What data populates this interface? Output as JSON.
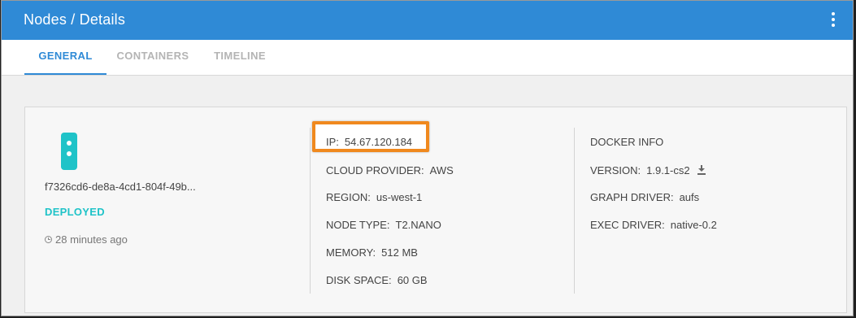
{
  "header": {
    "title": "Nodes / Details",
    "menu_icon": "more-vert-icon"
  },
  "tabs": [
    {
      "label": "GENERAL",
      "active": true
    },
    {
      "label": "CONTAINERS",
      "active": false
    },
    {
      "label": "TIMELINE",
      "active": false
    }
  ],
  "node": {
    "id": "f7326cd6-de8a-4cd1-804f-49b...",
    "status": "DEPLOYED",
    "time_ago": "28 minutes ago",
    "icon": "node-icon"
  },
  "details": [
    {
      "label": "IP:",
      "value": "54.67.120.184"
    },
    {
      "label": "CLOUD PROVIDER:",
      "value": "AWS"
    },
    {
      "label": "REGION:",
      "value": "us-west-1"
    },
    {
      "label": "NODE TYPE:",
      "value": "T2.NANO"
    },
    {
      "label": "MEMORY:",
      "value": "512 MB"
    },
    {
      "label": "DISK SPACE:",
      "value": "60 GB"
    }
  ],
  "docker": {
    "title": "DOCKER INFO",
    "version_label": "VERSION:",
    "version_value": "1.9.1-cs2",
    "graph_driver_label": "GRAPH DRIVER:",
    "graph_driver_value": "aufs",
    "exec_driver_label": "EXEC DRIVER:",
    "exec_driver_value": "native-0.2"
  },
  "colors": {
    "header": "#2f8ad6",
    "accent_teal": "#1fc3c8",
    "highlight": "#f0891e"
  }
}
